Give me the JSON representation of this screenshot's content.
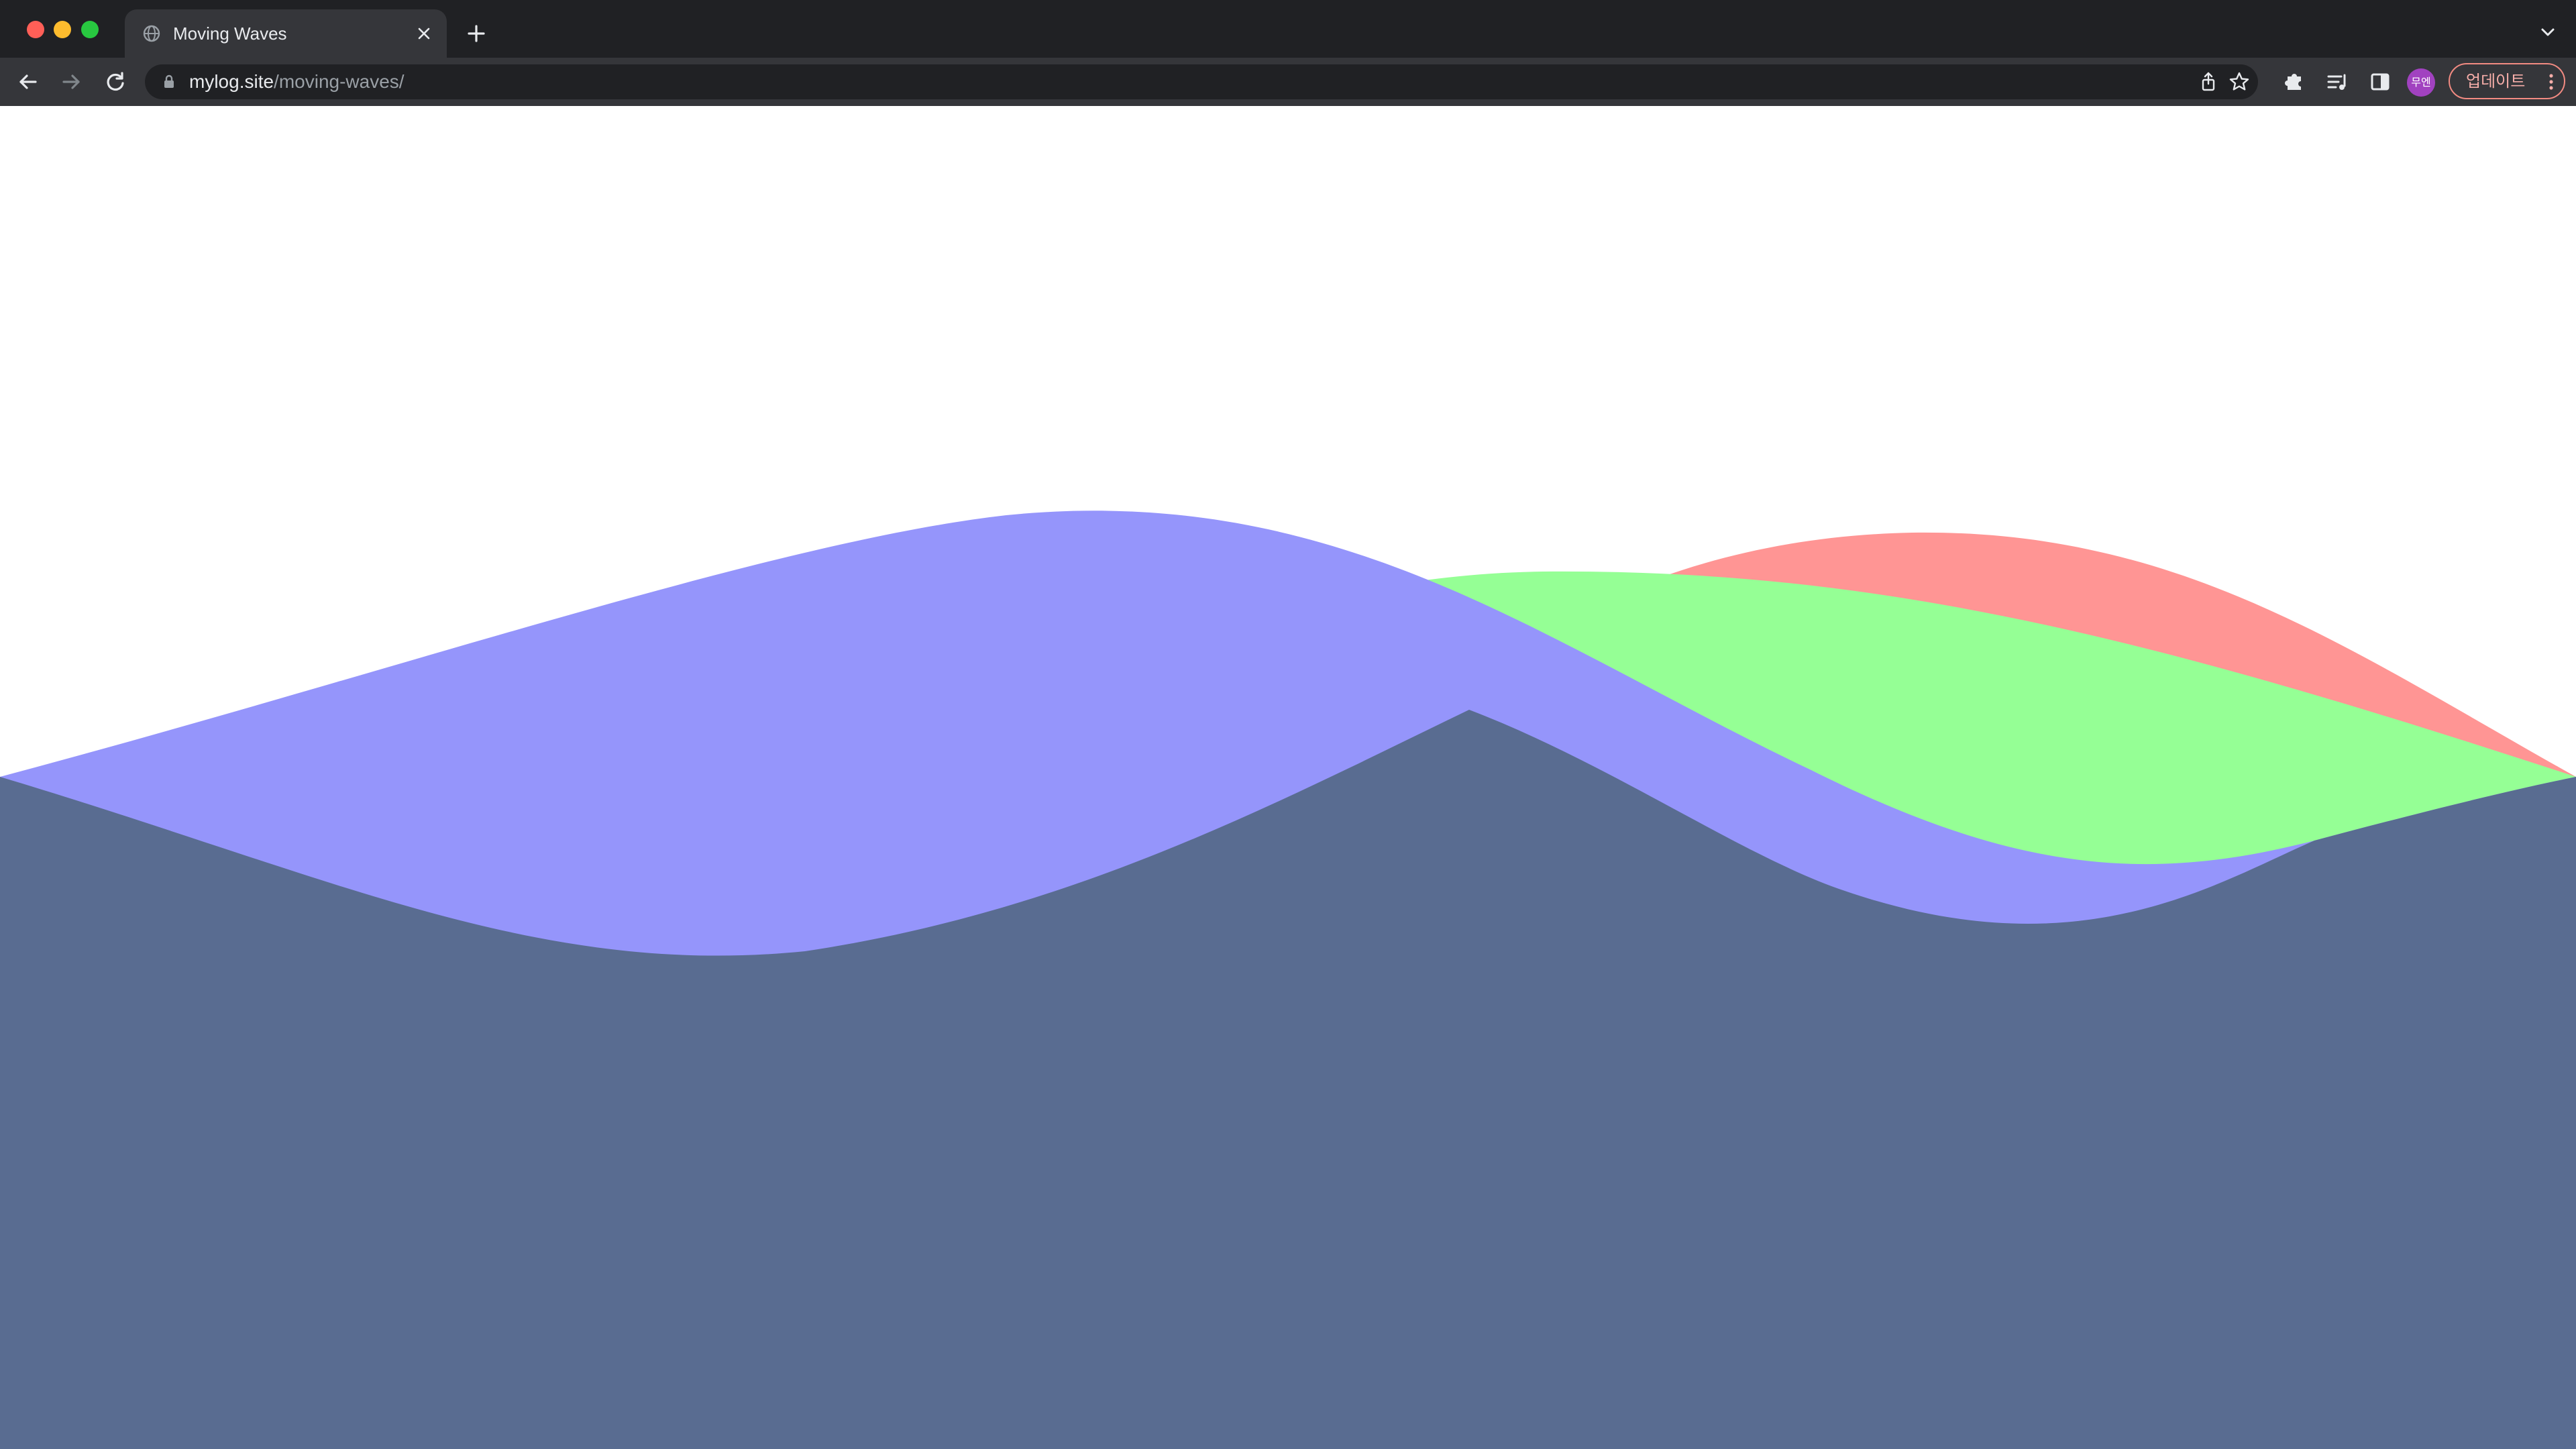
{
  "browser": {
    "tab": {
      "title": "Moving Waves",
      "favicon": "globe-icon"
    },
    "address": {
      "host": "mylog.site",
      "path": "/moving-waves/"
    },
    "profile_avatar": "무엔",
    "update_label": "업데이트",
    "icons": {
      "back": "back-arrow-icon",
      "forward": "forward-arrow-icon",
      "reload": "reload-icon",
      "lock": "lock-icon",
      "share": "share-icon",
      "bookmark": "star-icon",
      "extensions": "puzzle-icon",
      "reading_list": "reading-list-icon",
      "side_panel": "side-panel-icon",
      "menu": "kebab-menu-icon",
      "new_tab": "plus-icon",
      "close_tab": "close-icon",
      "tab_search": "chevron-down-icon"
    }
  },
  "scene": {
    "waves": [
      {
        "name": "red-wave",
        "color": "#ff9594"
      },
      {
        "name": "green-wave",
        "color": "#95ff95"
      },
      {
        "name": "blue-wave",
        "color": "#9595fb"
      }
    ],
    "base_color": "#596c91"
  }
}
